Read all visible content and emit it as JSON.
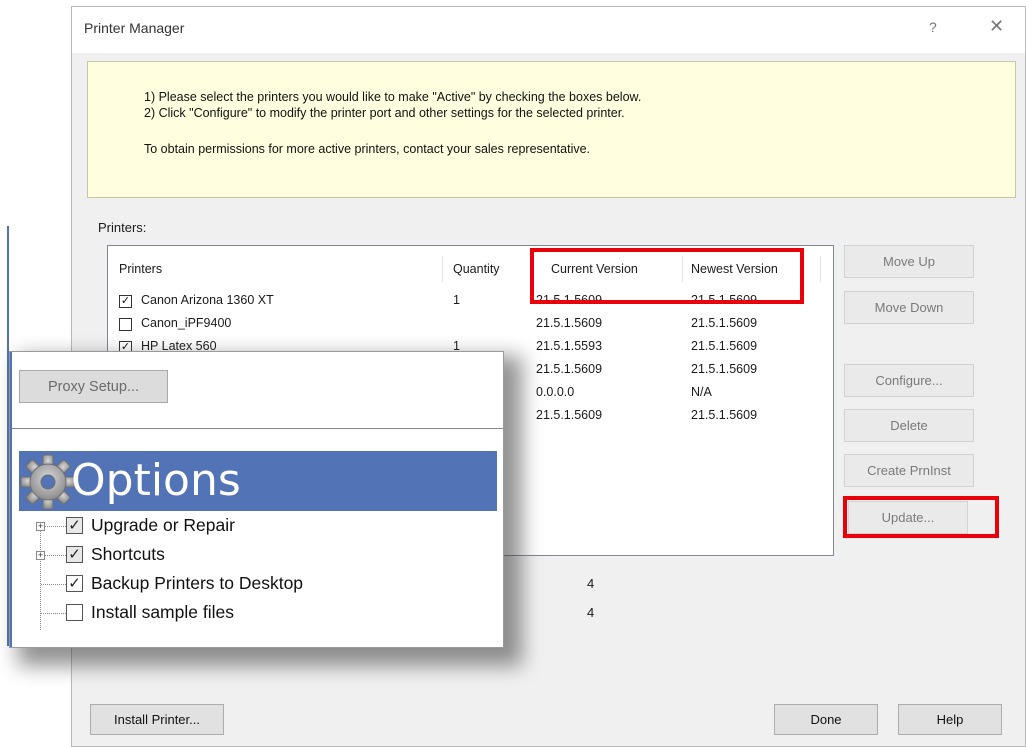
{
  "window": {
    "title": "Printer Manager",
    "help_glyph": "?",
    "close_glyph": "✕"
  },
  "instructions": {
    "line1": "1) Please select the printers you would like to make \"Active\" by checking the boxes below.",
    "line2": "2) Click \"Configure\" to modify the printer port and other settings for the selected printer.",
    "line3": "To obtain permissions for more active printers, contact your sales representative."
  },
  "printers_label": "Printers:",
  "columns": {
    "printers": "Printers",
    "quantity": "Quantity",
    "current": "Current Version",
    "newest": "Newest Version"
  },
  "rows": [
    {
      "name": "Canon Arizona 1360 XT",
      "checked": true,
      "qty": "1",
      "current": "21.5.1.5609",
      "newest": "21.5.1.5609"
    },
    {
      "name": "Canon_iPF9400",
      "checked": false,
      "qty": "",
      "current": "21.5.1.5609",
      "newest": "21.5.1.5609"
    },
    {
      "name": "HP Latex 560",
      "checked": true,
      "qty": "1",
      "current": "21.5.1.5593",
      "newest": "21.5.1.5609"
    },
    {
      "name": "",
      "checked": null,
      "qty": "",
      "current": "21.5.1.5609",
      "newest": "21.5.1.5609"
    },
    {
      "name": "",
      "checked": null,
      "qty": "",
      "current": "0.0.0.0",
      "newest": "N/A"
    },
    {
      "name": "",
      "checked": null,
      "qty": "",
      "current": "21.5.1.5609",
      "newest": "21.5.1.5609"
    }
  ],
  "side_buttons": {
    "move_up": "Move Up",
    "move_down": "Move Down",
    "configure": "Configure...",
    "delete": "Delete",
    "create_prninst": "Create PrnInst",
    "update": "Update..."
  },
  "stats": {
    "value1": "4",
    "value2": "4"
  },
  "bottom_buttons": {
    "install": "Install Printer...",
    "done": "Done",
    "help": "Help"
  },
  "options_panel": {
    "proxy_button": "Proxy Setup...",
    "title": "Options",
    "items": [
      {
        "label": "Upgrade or Repair",
        "checked": true,
        "expandable": true
      },
      {
        "label": "Shortcuts",
        "checked": true,
        "expandable": true
      },
      {
        "label": "Backup Printers to Desktop",
        "checked": true,
        "expandable": false
      },
      {
        "label": "Install sample files",
        "checked": false,
        "expandable": false
      }
    ]
  },
  "colors": {
    "highlight": "#e8000b",
    "instructions_bg": "#ffffdf",
    "options_header_bg": "#5273b5",
    "dialog_bg": "#f0f0f0"
  }
}
